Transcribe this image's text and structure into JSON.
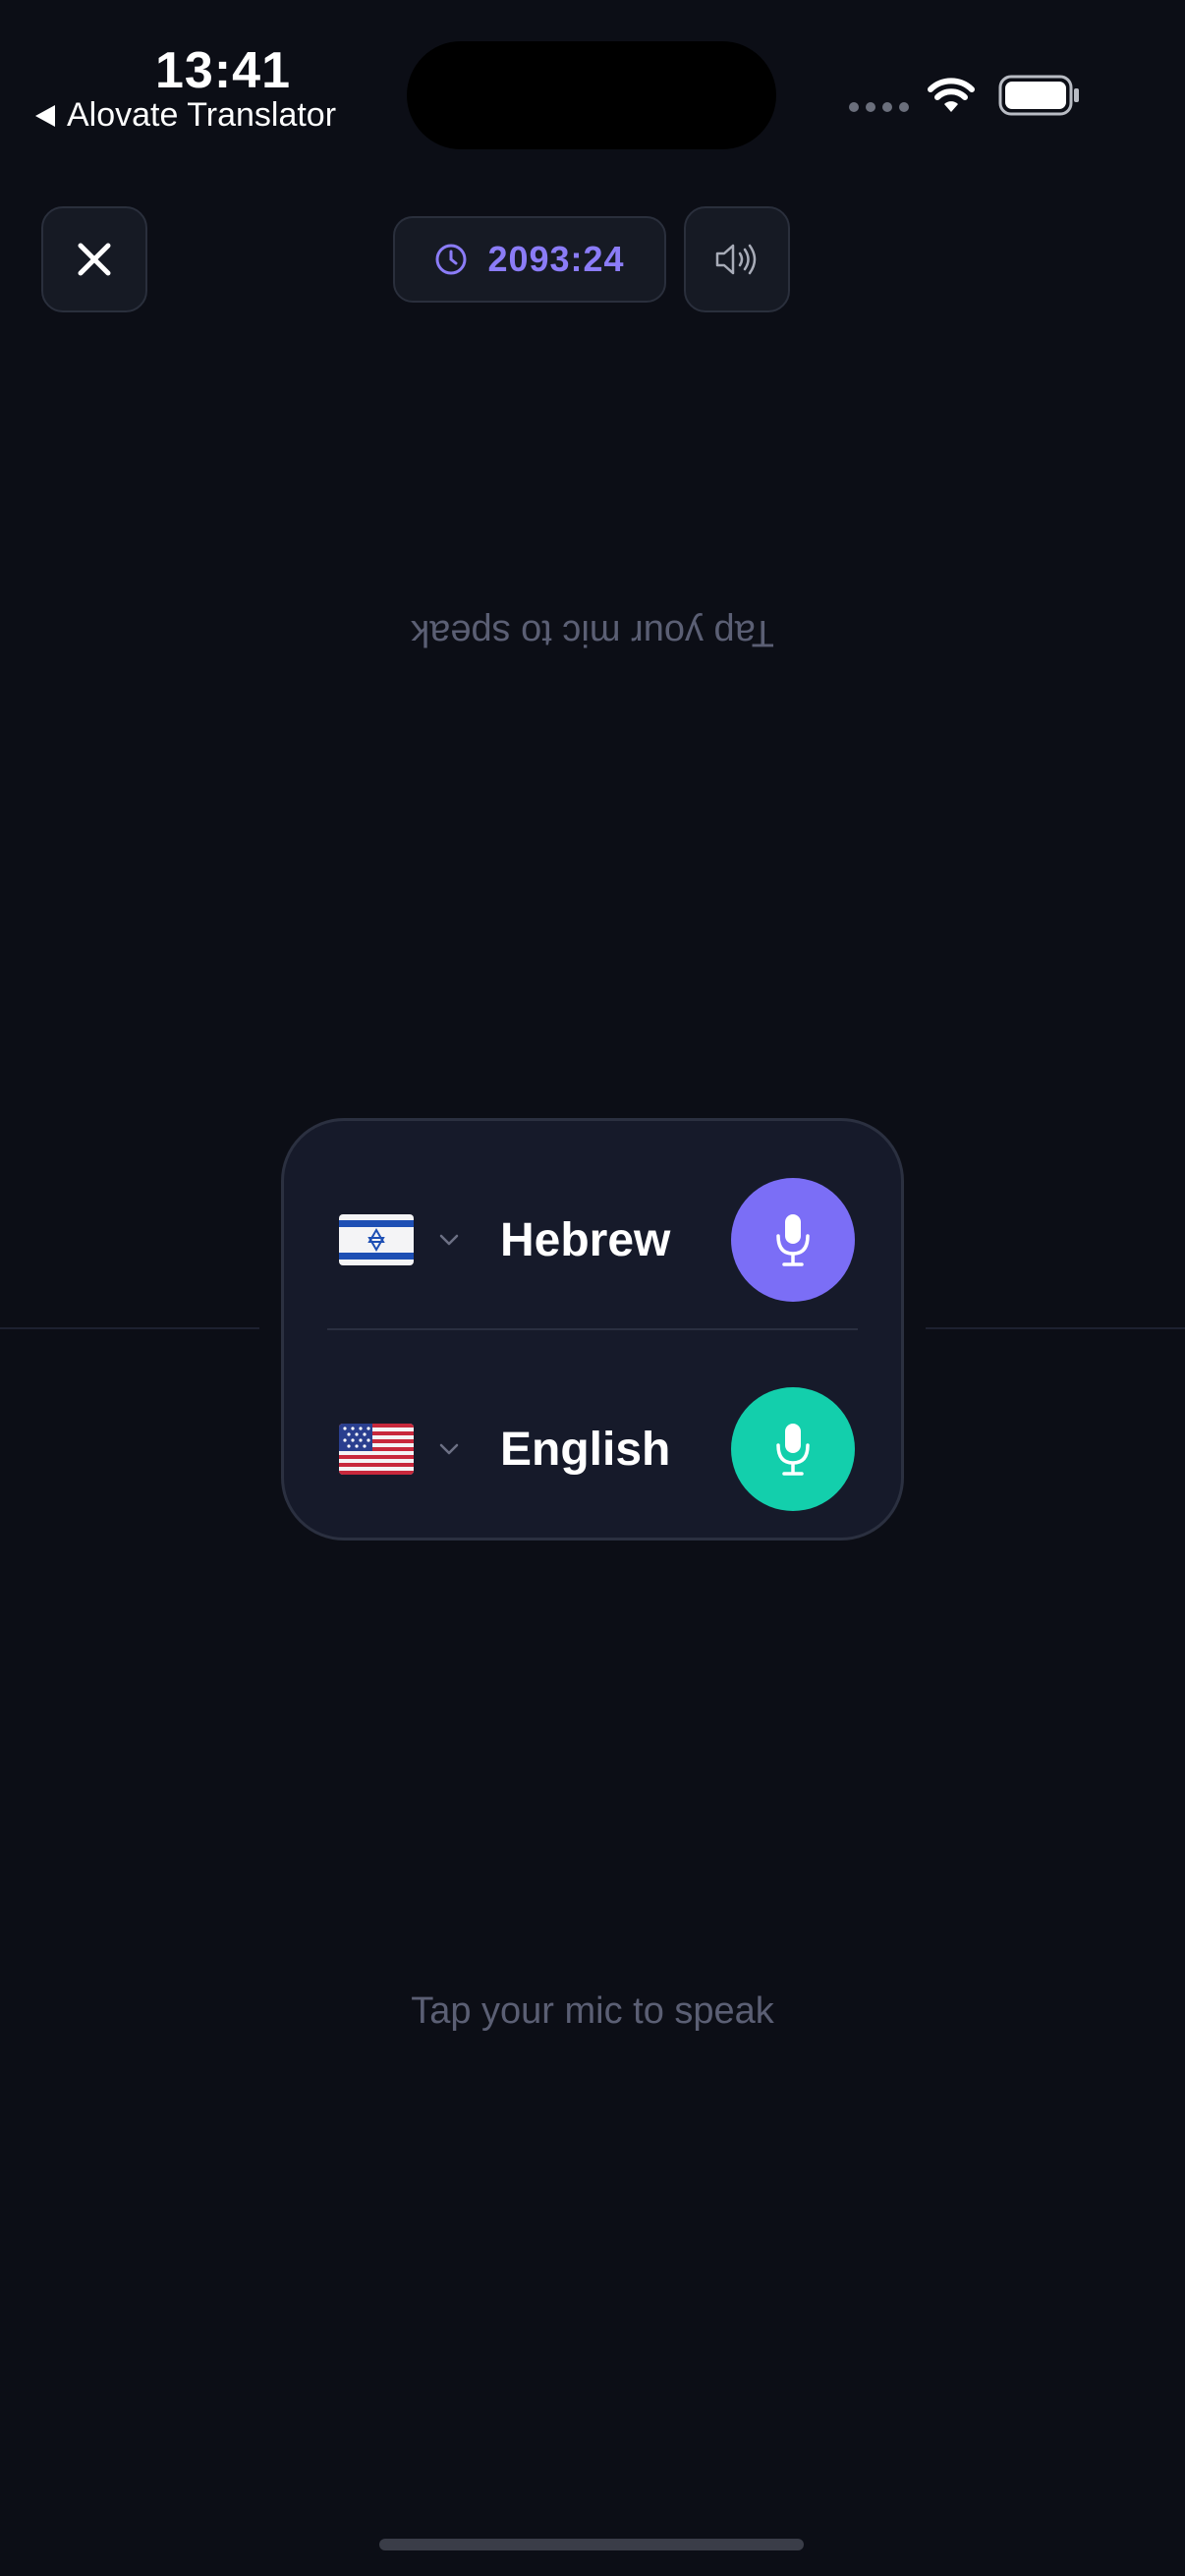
{
  "status_bar": {
    "time": "13:41",
    "back_app": "Alovate Translator",
    "wifi_icon": "wifi-icon",
    "battery_icon": "battery-icon"
  },
  "toolbar": {
    "close_icon": "close-icon",
    "timer": "2093:24",
    "timer_icon": "clock-icon",
    "speaker_icon": "speaker-icon"
  },
  "prompts": {
    "top": "Tap your mic to speak",
    "bottom": "Tap your mic to speak"
  },
  "languages": {
    "top": {
      "name": "Hebrew",
      "flag": "israel-flag",
      "mic_color": "#7b6ef6"
    },
    "bottom": {
      "name": "English",
      "flag": "us-flag",
      "mic_color": "#13cfac"
    }
  },
  "colors": {
    "background": "#0c0e16",
    "accent_purple": "#7b6ef6",
    "accent_green": "#13cfac",
    "muted_text": "#5b5f74"
  }
}
